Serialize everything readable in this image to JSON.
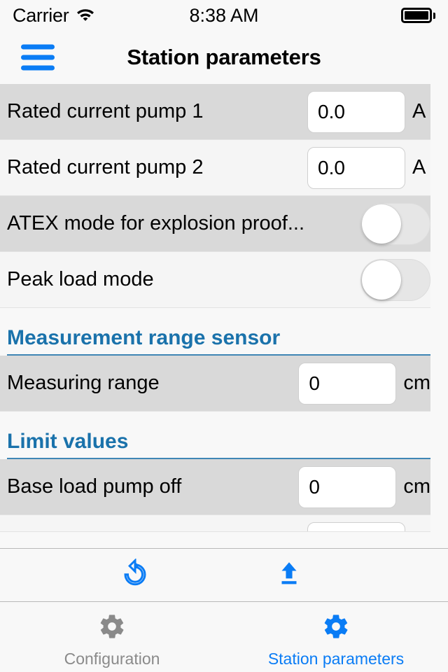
{
  "status_bar": {
    "carrier": "Carrier",
    "wifi_icon": "wifi-icon",
    "time": "8:38 AM",
    "battery_icon": "battery-full-icon"
  },
  "nav": {
    "menu_icon": "hamburger-menu-icon",
    "title": "Station parameters"
  },
  "colors": {
    "accent_blue": "#0a7cf5",
    "section_blue": "#1a72ab",
    "row_dark": "#d9d9d9",
    "row_light": "#f5f5f5",
    "inactive_gray": "#8a8a8a"
  },
  "list": [
    {
      "type": "field",
      "label": "Rated current pump 1",
      "value": "0.0",
      "unit": "A",
      "shade": "dark"
    },
    {
      "type": "field",
      "label": "Rated current pump 2",
      "value": "0.0",
      "unit": "A",
      "shade": "light"
    },
    {
      "type": "toggle",
      "label": "ATEX mode for explosion proof...",
      "state": "off",
      "shade": "dark"
    },
    {
      "type": "toggle",
      "label": "Peak load mode",
      "state": "off",
      "shade": "light"
    },
    {
      "type": "section",
      "title": "Measurement range sensor"
    },
    {
      "type": "field",
      "label": "Measuring range",
      "value": "0",
      "unit": "cm",
      "shade": "dark"
    },
    {
      "type": "section",
      "title": "Limit values"
    },
    {
      "type": "field",
      "label": "Base load pump off",
      "value": "0",
      "unit": "cm",
      "shade": "dark"
    }
  ],
  "toolbar": {
    "refresh_icon": "refresh-icon",
    "upload_icon": "upload-icon"
  },
  "tabs": [
    {
      "label": "Configuration",
      "icon": "gear-icon",
      "active": false
    },
    {
      "label": "Station parameters",
      "icon": "gear-icon",
      "active": true
    }
  ]
}
